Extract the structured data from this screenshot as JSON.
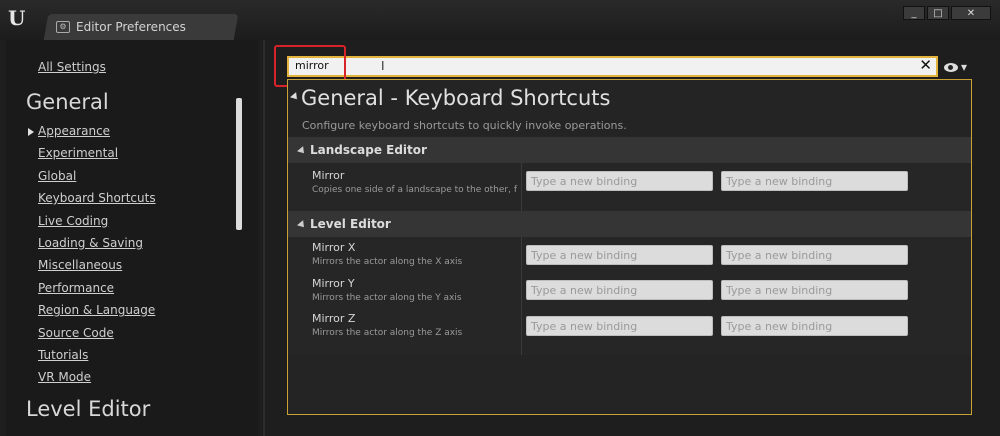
{
  "window": {
    "tab_title": "Editor Preferences",
    "logo": "U",
    "tab_icon": "settings-window-icon",
    "controls": [
      "_",
      "□",
      "✕"
    ]
  },
  "sidebar": {
    "all_settings": "All Settings",
    "section_general": "General",
    "items": [
      {
        "label": "Appearance"
      },
      {
        "label": "Experimental"
      },
      {
        "label": "Global"
      },
      {
        "label": "Keyboard Shortcuts"
      },
      {
        "label": "Live Coding"
      },
      {
        "label": "Loading & Saving"
      },
      {
        "label": "Miscellaneous"
      },
      {
        "label": "Performance"
      },
      {
        "label": "Region & Language"
      },
      {
        "label": "Source Code"
      },
      {
        "label": "Tutorials"
      },
      {
        "label": "VR Mode"
      }
    ],
    "section_level_editor": "Level Editor"
  },
  "search": {
    "value": "mirror",
    "caret": "I",
    "clear": "✕"
  },
  "panel": {
    "title": "General - Keyboard Shortcuts",
    "description": "Configure keyboard shortcuts to quickly invoke operations.",
    "categories": [
      {
        "label": "Landscape Editor",
        "rows": [
          {
            "name": "Mirror",
            "description": "Copies one side of a landscape to the other, f",
            "binding1": "Type a new binding",
            "binding2": "Type a new binding"
          }
        ]
      },
      {
        "label": "Level Editor",
        "rows": [
          {
            "name": "Mirror X",
            "description": "Mirrors the actor along the X axis",
            "binding1": "Type a new binding",
            "binding2": "Type a new binding"
          },
          {
            "name": "Mirror Y",
            "description": "Mirrors the actor along the Y axis",
            "binding1": "Type a new binding",
            "binding2": "Type a new binding"
          },
          {
            "name": "Mirror Z",
            "description": "Mirrors the actor along the Z axis",
            "binding1": "Type a new binding",
            "binding2": "Type a new binding"
          }
        ]
      }
    ]
  },
  "colors": {
    "accent": "#e2b43c",
    "highlight_annotation": "#d9232a"
  }
}
